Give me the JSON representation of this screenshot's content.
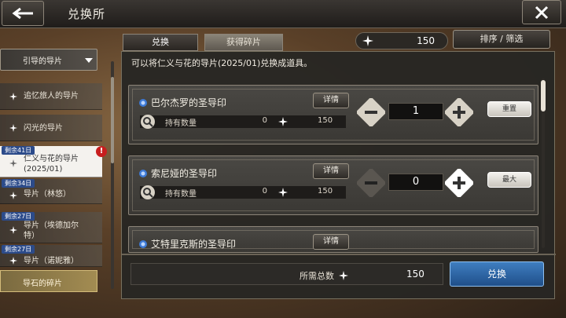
{
  "header": {
    "title": "兑换所"
  },
  "tabs": [
    {
      "label": "兑换"
    },
    {
      "label": "获得碎片"
    }
  ],
  "currency": {
    "value": "150"
  },
  "sort_label": "排序 / 筛选",
  "sidebar": {
    "top": "引导的导片",
    "items": [
      {
        "label": "追忆旅人的导片"
      },
      {
        "label": "闪光的导片"
      },
      {
        "remain": "剩余41日",
        "label": "仁义与花的导片(2025/01)",
        "alert": "!"
      },
      {
        "remain": "剩余34日",
        "label": "导片（林悠）"
      },
      {
        "remain": "剩余27日",
        "label": "导片（埃德加尔特）"
      },
      {
        "remain": "剩余27日",
        "label": "导片（诺妮雅）"
      }
    ],
    "bottom": "导石的碎片"
  },
  "description": "可以将仁义与花的导片(2025/01)兑换成道具。",
  "cards": [
    {
      "name": "巴尔杰罗的圣导印",
      "detail": "详情",
      "hold_label": "持有数量",
      "hold": "0",
      "cost": "150",
      "qty": "1",
      "action": "重置"
    },
    {
      "name": "索尼娅的圣导印",
      "detail": "详情",
      "hold_label": "持有数量",
      "hold": "0",
      "cost": "150",
      "qty": "0",
      "action": "最大"
    },
    {
      "name": "艾特里克斯的圣导印",
      "detail": "详情"
    }
  ],
  "footer": {
    "total_label": "所需总数",
    "total_value": "150",
    "exchange": "兑换"
  }
}
